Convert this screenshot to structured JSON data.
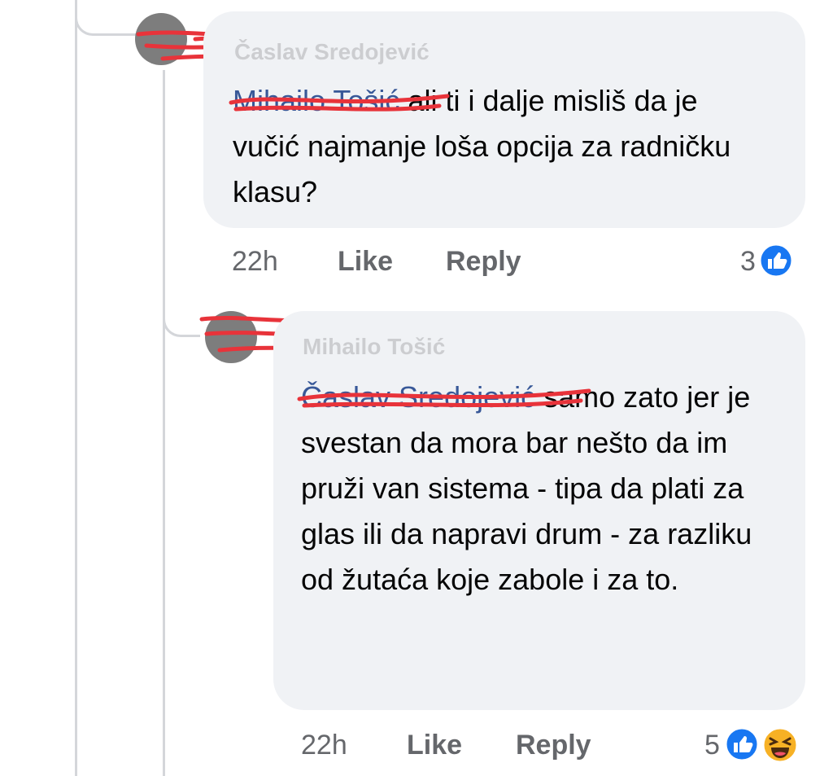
{
  "comments": [
    {
      "author": "Časlav Sredojević",
      "mention": "Mihailo Tošić",
      "text": "ali ti i dalje misliš da je vučić najmanje loša opcija za radničku klasu?",
      "time": "22h",
      "like_label": "Like",
      "reply_label": "Reply",
      "reaction_count": "3",
      "reactions": [
        "like-icon"
      ]
    },
    {
      "author": "Mihailo Tošić",
      "mention": "Časlav Sredojević",
      "text": "samo zato jer je svestan da mora bar nešto da im pruži van sistema - tipa da plati za glas ili da napravi drum - za razliku od žutaća koje zabole i za to.",
      "time": "22h",
      "like_label": "Like",
      "reply_label": "Reply",
      "reaction_count": "5",
      "reactions": [
        "like-icon",
        "haha-icon"
      ]
    }
  ],
  "colors": {
    "bubble": "#f0f2f5",
    "mention": "#385898",
    "meta": "#65676b",
    "like_blue": "#1877f2",
    "haha_yellow": "#f7b125",
    "redaction": "#e8333a"
  }
}
